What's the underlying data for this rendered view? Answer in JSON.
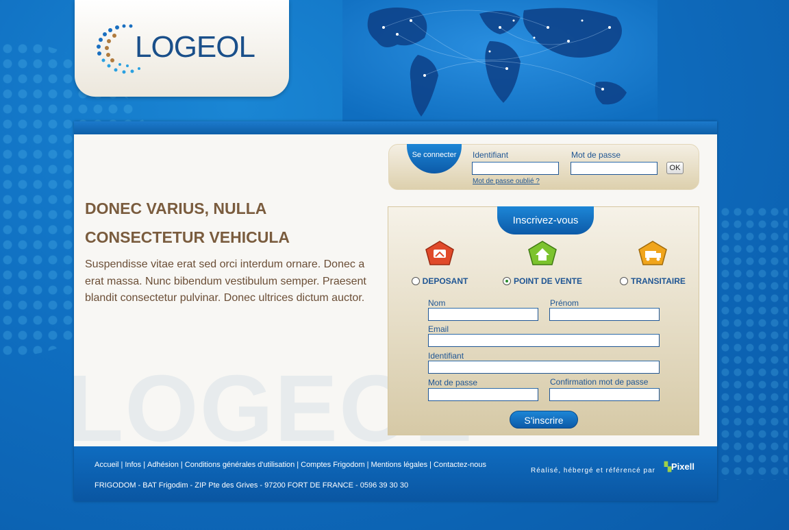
{
  "brand": {
    "logo_text": "LOGEOL",
    "watermark_text": "LOGEOL"
  },
  "hero": {
    "headline_line1": "DONEC VARIUS, NULLA",
    "headline_line2": "CONSECTETUR VEHICULA",
    "paragraph": "Suspendisse vitae erat sed orci interdum ornare. Donec a erat massa. Nunc bibendum vestibulum semper. Praesent blandit consectetur pulvinar. Donec ultrices dictum auctor."
  },
  "login": {
    "tab_label": "Se connecter",
    "identifiant_label": "Identifiant",
    "password_label": "Mot de passe",
    "identifiant_value": "",
    "password_value": "",
    "ok_label": "OK",
    "forgot_link": "Mot de passe oublié ?"
  },
  "register": {
    "tab_label": "Inscrivez-vous",
    "roles": [
      {
        "label": "DEPOSANT",
        "selected": false,
        "color": "#e04a2a"
      },
      {
        "label": "POINT DE VENTE",
        "selected": true,
        "color": "#7cc32e"
      },
      {
        "label": "TRANSITAIRE",
        "selected": false,
        "color": "#f0a51c"
      }
    ],
    "fields": {
      "nom": "Nom",
      "prenom": "Prénom",
      "email": "Email",
      "identifiant": "Identifiant",
      "mot_de_passe": "Mot de passe",
      "confirmation": "Confirmation mot de passe"
    },
    "submit_label": "S'inscrire"
  },
  "footer": {
    "links": [
      "Accueil",
      "Infos",
      "Adhésion",
      "Conditions générales d'utilisation",
      "Comptes Frigodom",
      "Mentions légales",
      "Contactez-nous"
    ],
    "address": "FRIGODOM - BAT Frigodim - ZIP Pte des Grives - 97200 FORT DE FRANCE - 0596 39 30 30",
    "credit": "Réalisé, hébergé et référencé par",
    "credit_brand": "Pixell"
  },
  "colors": {
    "primary_blue": "#0f6ec0",
    "text_brown": "#7a5c3e",
    "label_blue": "#1f5593"
  }
}
